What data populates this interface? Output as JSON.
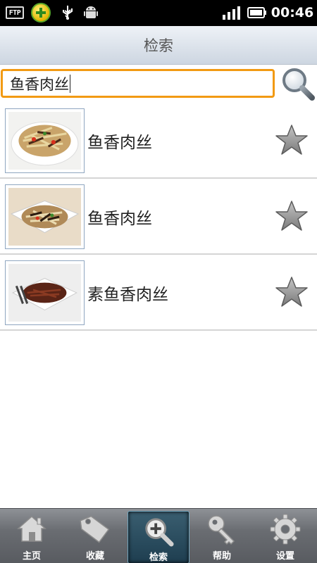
{
  "status_bar": {
    "left_icons": [
      "ftp-icon",
      "plus-360-icon",
      "usb-icon",
      "android-icon"
    ],
    "ftp_label": "FTP",
    "time": "00:46"
  },
  "header": {
    "title": "检索"
  },
  "search": {
    "value": "鱼香肉丝",
    "icon": "search-icon"
  },
  "results": [
    {
      "title": "鱼香肉丝",
      "icon": "star-icon"
    },
    {
      "title": "鱼香肉丝",
      "icon": "star-icon"
    },
    {
      "title": "素鱼香肉丝",
      "icon": "star-icon"
    }
  ],
  "tabbar": {
    "tabs": [
      {
        "label": "主页",
        "icon": "home-icon"
      },
      {
        "label": "收藏",
        "icon": "tag-icon"
      },
      {
        "label": "检索",
        "icon": "search-plus-icon",
        "active": true
      },
      {
        "label": "帮助",
        "icon": "key-icon"
      },
      {
        "label": "设置",
        "icon": "gear-icon"
      }
    ]
  },
  "colors": {
    "accent": "#f29a13",
    "header_bg": "#dde4ec",
    "tabbar_bg": "#6a6d72",
    "active_tab": "#2a4e60"
  }
}
